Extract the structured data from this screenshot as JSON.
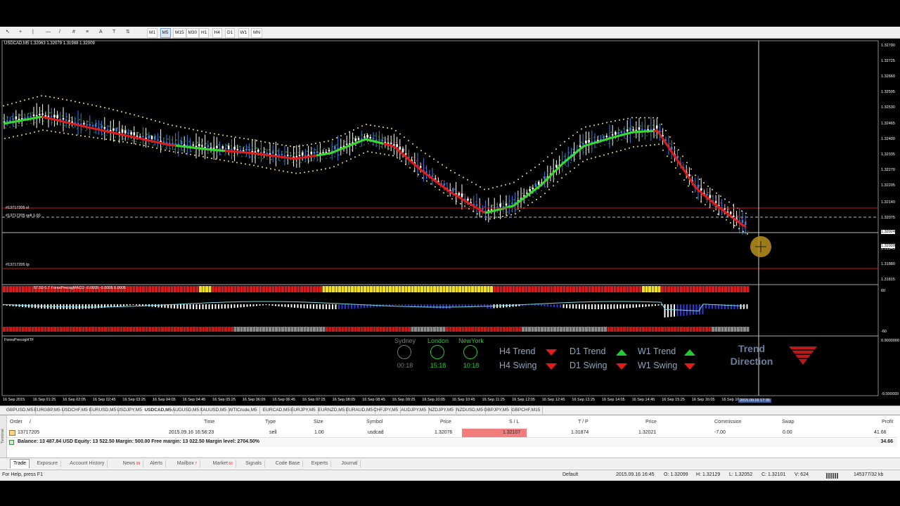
{
  "toolbar": {
    "icons": [
      "cursor-icon",
      "crosshair-icon",
      "vertical-line-icon",
      "horizontal-line-icon",
      "trendline-icon",
      "channel-icon",
      "fibonacci-icon",
      "text-icon",
      "text-label-icon",
      "arrows-icon"
    ],
    "timeframes": [
      "M1",
      "M5",
      "M15",
      "M30",
      "H1",
      "H4",
      "D1",
      "W1",
      "MN"
    ],
    "active_timeframe": "M5"
  },
  "chart": {
    "header": "USDCAD,M5  1.32063 1.32079 1.31988 1.32009",
    "order_sl_label": "#13717205 sl",
    "order_entry_label": "#13717205 sell 1.00",
    "order_tp_label": "#13717205 tp",
    "indicator_label": "57.50 0.7  ForexPrecogMACD -0.0005 -0.0005 0.0005",
    "htf_label": "ForexPrecogHTF",
    "price_axis": [
      "1.32790",
      "1.32725",
      "1.32660",
      "1.32595",
      "1.32530",
      "1.32465",
      "1.32400",
      "1.32335",
      "1.32270",
      "1.32205",
      "1.32140",
      "1.32075",
      "1.32024",
      "1.32009",
      "1.31945",
      "1.31880",
      "1.31815"
    ],
    "macd_axis": [
      "60",
      "-60"
    ],
    "htf_axis": [
      "0.9000000",
      "-9.000000"
    ],
    "time_axis": [
      "16 Sep 2015",
      "16 Sep 01:25",
      "16 Sep 02:05",
      "16 Sep 02:45",
      "16 Sep 03:25",
      "16 Sep 04:05",
      "16 Sep 04:45",
      "16 Sep 05:25",
      "16 Sep 06:05",
      "16 Sep 06:45",
      "16 Sep 07:25",
      "16 Sep 08:05",
      "16 Sep 08:45",
      "16 Sep 09:25",
      "16 Sep 10:05",
      "16 Sep 10:45",
      "16 Sep 11:25",
      "16 Sep 12:05",
      "16 Sep 12:45",
      "16 Sep 13:25",
      "16 Sep 14:05",
      "16 Sep 14:45",
      "16 Sep 15:25",
      "16 Sep 16:05",
      "16 Sep 16"
    ],
    "crosshair_time": "2015.09.16 17:35"
  },
  "htf": {
    "sessions": [
      {
        "city": "Sydney",
        "time": "00:18",
        "color": "#777777"
      },
      {
        "city": "London",
        "time": "15:18",
        "color": "#22cc33"
      },
      {
        "city": "NewYork",
        "time": "10:18",
        "color": "#22cc33"
      }
    ],
    "trends": [
      {
        "label": "H4 Trend",
        "dir": "down"
      },
      {
        "label": "D1 Trend",
        "dir": "up"
      },
      {
        "label": "W1 Trend",
        "dir": "up"
      },
      {
        "label": "H4 Swing",
        "dir": "down"
      },
      {
        "label": "D1 Swing",
        "dir": "down"
      },
      {
        "label": "W1 Swing",
        "dir": "down"
      }
    ],
    "trend_direction_title_1": "Trend",
    "trend_direction_title_2": "Direction",
    "colors": {
      "up": "#22cc33",
      "down": "#e21a1a",
      "label": "#8fa3c0"
    }
  },
  "symbol_tabs": [
    "GBPUSD,M5",
    "EURGBP,M5",
    "USDCHF,M5",
    "EURUSD,M5",
    "USDJPY,M5",
    "USDCAD,M5",
    "AUDUSD,M5",
    "XAUUSD,M5",
    ".WTICrude,M5",
    "EURCAD,M5",
    "EURJPY,M5",
    "EURNZD,M5",
    "EURAUD,M5",
    "CHFJPY,M5",
    "AUDJPY,M5",
    "NZDJPY,M5",
    "NZDUSD,M5",
    "GBPJPY,M5",
    "GBPCHF,M15"
  ],
  "active_symbol": "USDCAD,M5",
  "terminal": {
    "columns": [
      "Order",
      "/",
      "Time",
      "Type",
      "Size",
      "Symbol",
      "Price",
      "S / L",
      "T / P",
      "Price",
      "Commission",
      "Swap",
      "Profit"
    ],
    "order": {
      "id": "13717205",
      "time": "2015.09.16 16:56:23",
      "type": "sell",
      "size": "1.00",
      "symbol": "usdcad",
      "price": "1.32076",
      "sl": "1.32107",
      "tp": "1.31874",
      "cur_price": "1.32021",
      "commission": "-7.00",
      "swap": "0.00",
      "profit": "41.66"
    },
    "balance_line": "Balance: 13 487.84 USD  Equity: 13 522.50  Margin: 500.00  Free margin: 13 022.50  Margin level: 2704.50%",
    "total_profit": "34.66",
    "side_label": "Terminal",
    "tabs": [
      {
        "label": "Trade",
        "badge": ""
      },
      {
        "label": "Exposure",
        "badge": ""
      },
      {
        "label": "Account History",
        "badge": ""
      },
      {
        "label": "News",
        "badge": "99"
      },
      {
        "label": "Alerts",
        "badge": ""
      },
      {
        "label": "Mailbox",
        "badge": "7"
      },
      {
        "label": "Market",
        "badge": "60"
      },
      {
        "label": "Signals",
        "badge": ""
      },
      {
        "label": "Code Base",
        "badge": ""
      },
      {
        "label": "Experts",
        "badge": ""
      },
      {
        "label": "Journal",
        "badge": ""
      }
    ],
    "active_tab": "Trade"
  },
  "statusbar": {
    "help": "For Help, press F1",
    "profile": "Default",
    "datetime": "2015.09.16 16:45",
    "open": "O: 1.32099",
    "high": "H: 1.32129",
    "low": "L: 1.32052",
    "close": "C: 1.32101",
    "volume": "V: 624",
    "traffic": "145377/32 kb"
  }
}
